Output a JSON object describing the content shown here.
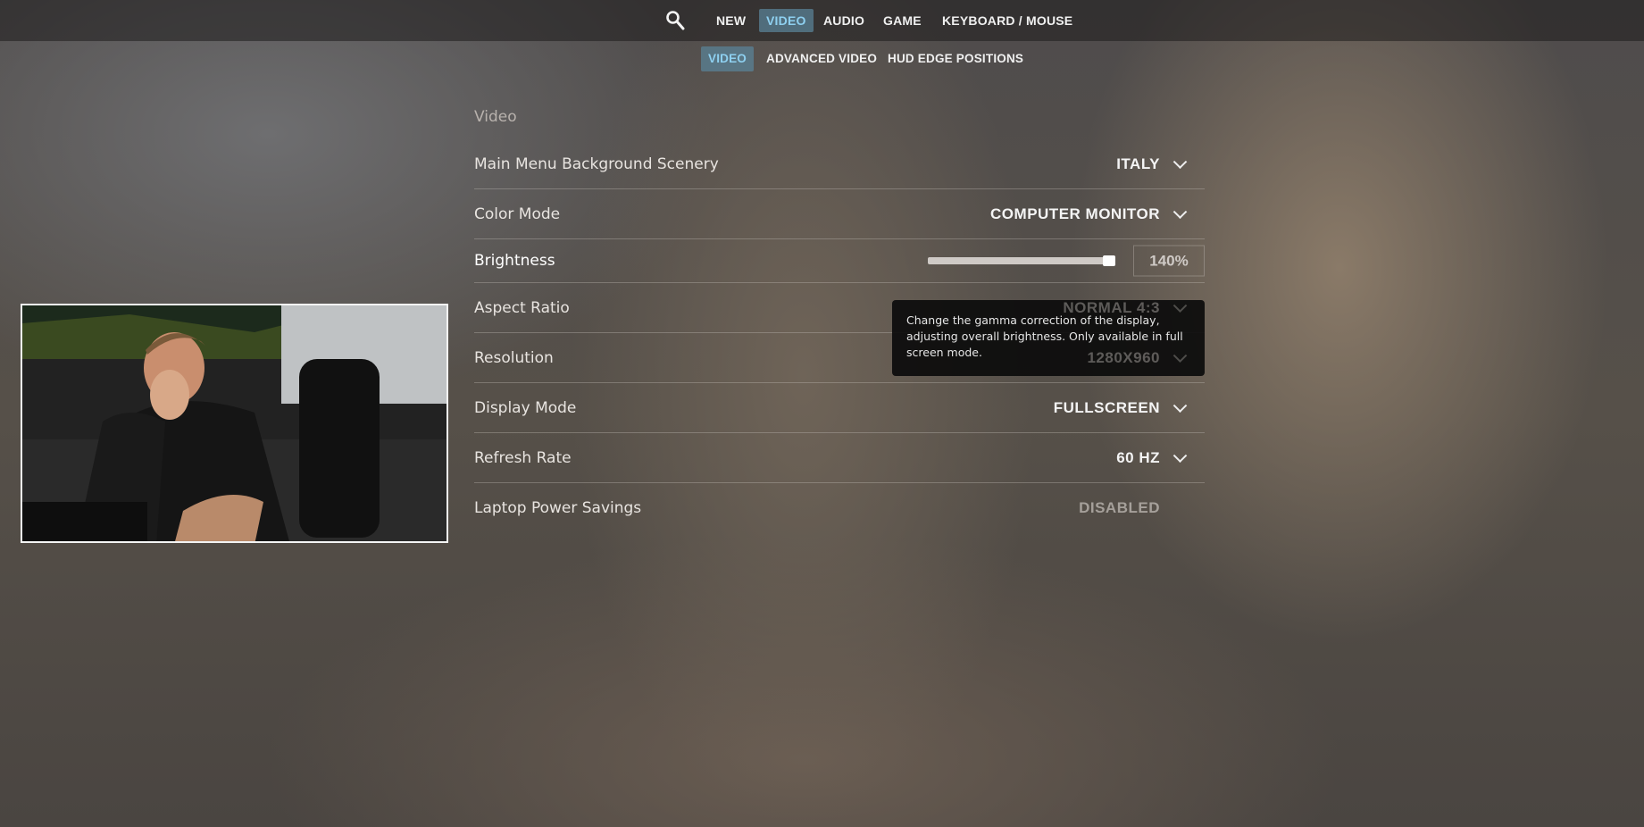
{
  "nav": {
    "tabs": [
      {
        "label": "NEW"
      },
      {
        "label": "VIDEO",
        "active": true
      },
      {
        "label": "AUDIO"
      },
      {
        "label": "GAME"
      },
      {
        "label": "KEYBOARD / MOUSE"
      }
    ],
    "subtabs": [
      {
        "label": "VIDEO",
        "active": true
      },
      {
        "label": "ADVANCED VIDEO"
      },
      {
        "label": "HUD EDGE POSITIONS"
      }
    ]
  },
  "section_title": "Video",
  "settings": [
    {
      "label": "Main Menu Background Scenery",
      "value": "ITALY"
    },
    {
      "label": "Color Mode",
      "value": "COMPUTER MONITOR"
    },
    {
      "label": "Brightness",
      "value": "140%",
      "slider_fraction": 1.0
    },
    {
      "label": "Aspect Ratio",
      "value": "NORMAL 4:3"
    },
    {
      "label": "Resolution",
      "value": "1280X960"
    },
    {
      "label": "Display Mode",
      "value": "FULLSCREEN"
    },
    {
      "label": "Refresh Rate",
      "value": "60 HZ"
    },
    {
      "label": "Laptop Power Savings",
      "value": "DISABLED"
    }
  ],
  "tooltip": "Change the gamma correction of the display, adjusting overall brightness. Only available in full screen mode.",
  "colors": {
    "accent": "#8ed0f0",
    "tab_active_bg": "#5a8296"
  }
}
